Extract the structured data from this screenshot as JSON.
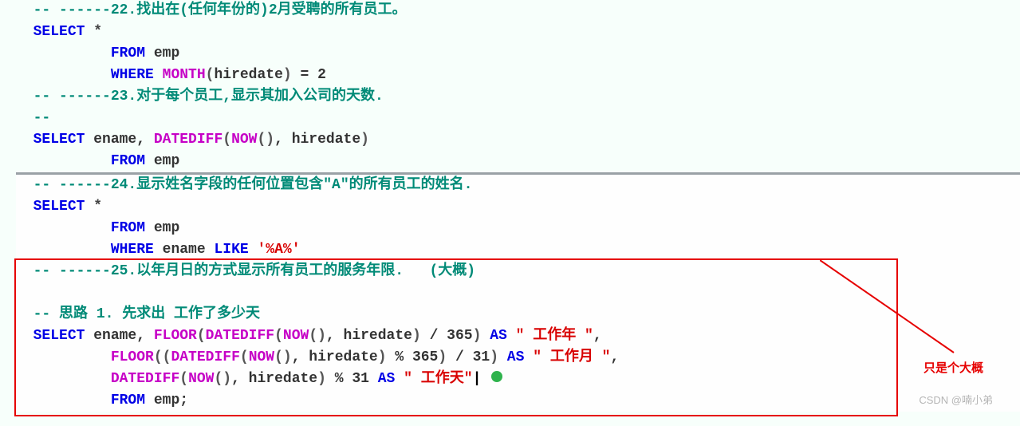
{
  "l1": {
    "prefix": "-- ------",
    "text": "22.找出在(任何年份的)2月受聘的所有员工。"
  },
  "l2": {
    "select": "SELECT",
    "star": " *"
  },
  "l3": {
    "from": "FROM",
    "tbl": " emp"
  },
  "l4": {
    "where": "WHERE",
    "fn": " MONTH",
    "p1": "(",
    "id": "hiredate",
    "p2": ")",
    "op": " = ",
    "num": "2"
  },
  "l5": {
    "prefix": "-- ------",
    "text": "23.对于每个员工,显示其加入公司的天数."
  },
  "l6": {
    "dashes": "--"
  },
  "l7": {
    "select": "SELECT",
    "col": " ename, ",
    "fn": "DATEDIFF",
    "p1": "(",
    "fn2": "NOW",
    "p2": "()",
    "comma": ", ",
    "id": "hiredate",
    "p3": ")"
  },
  "l8": {
    "from": "FROM",
    "tbl": " emp"
  },
  "l9": {
    "prefix": "-- ------",
    "text": "24.显示姓名字段的任何位置包含\"A\"的所有员工的姓名."
  },
  "l10": {
    "select": "SELECT",
    "star": " *"
  },
  "l11": {
    "from": "FROM",
    "tbl": " emp"
  },
  "l12": {
    "where": "WHERE",
    "col": " ename ",
    "like": "LIKE",
    "str": " '%A%'"
  },
  "l13": {
    "prefix": "-- ------",
    "text": "25.以年月日的方式显示所有员工的服务年限.   (大概)"
  },
  "l14": {
    "text": ""
  },
  "l15": {
    "text": "-- 思路 1. 先求出 工作了多少天"
  },
  "l16a": "SELECT",
  "l16b": " ename, ",
  "l16c": "FLOOR",
  "l16d": "(",
  "l16e": "DATEDIFF",
  "l16f": "(",
  "l16g": "NOW",
  "l16h": "()",
  "l16i": ", hiredate",
  "l16j": ")",
  "l16k": " / ",
  "l16l": "365",
  "l16m": ")",
  "l16n": " AS ",
  "l16o": "\" 工作年 \"",
  "l16p": ",",
  "l17a": "FLOOR",
  "l17b": "((",
  "l17c": "DATEDIFF",
  "l17d": "(",
  "l17e": "NOW",
  "l17f": "()",
  "l17g": ", hiredate",
  "l17h": ")",
  "l17i": " % ",
  "l17j": "365",
  "l17k": ")",
  "l17l": " / ",
  "l17m": "31",
  "l17n": ")",
  "l17o": " AS ",
  "l17p": "\" 工作月 \"",
  "l17q": ",",
  "l18a": "DATEDIFF",
  "l18b": "(",
  "l18c": "NOW",
  "l18d": "()",
  "l18e": ", hiredate",
  "l18f": ")",
  "l18g": " % ",
  "l18h": "31",
  "l18i": " AS ",
  "l18j": "\" 工作天\"",
  "l19a": "FROM",
  "l19b": " emp;",
  "annot": "只是个大概",
  "watermark": "CSDN @喃小弟"
}
